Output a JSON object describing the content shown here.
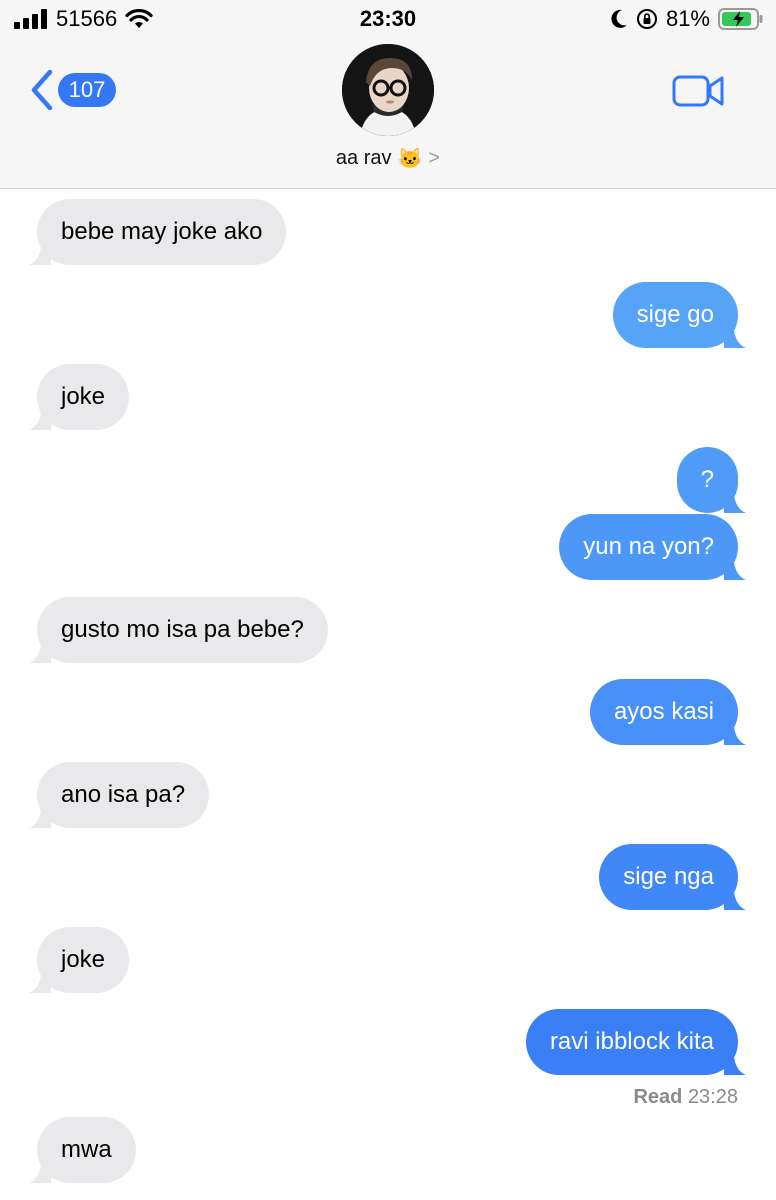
{
  "status": {
    "carrier": "51566",
    "time": "23:30",
    "battery": "81%"
  },
  "header": {
    "back_count": "107",
    "contact_name": "aa rav",
    "contact_emoji": "🐱",
    "chevron": ">"
  },
  "messages": [
    {
      "dir": "in",
      "text": "bebe may joke ako"
    },
    {
      "dir": "out",
      "text": "sige go"
    },
    {
      "dir": "in",
      "text": "joke"
    },
    {
      "dir": "out",
      "text": "?"
    },
    {
      "dir": "out",
      "text": "yun na yon?"
    },
    {
      "dir": "in",
      "text": "gusto mo isa pa bebe?"
    },
    {
      "dir": "out",
      "text": "ayos kasi"
    },
    {
      "dir": "in",
      "text": "ano isa pa?"
    },
    {
      "dir": "out",
      "text": "sige nga"
    },
    {
      "dir": "in",
      "text": "joke"
    },
    {
      "dir": "out",
      "text": "ravi ibblock kita"
    },
    {
      "dir": "in",
      "text": "mwa"
    }
  ],
  "receipt": {
    "label": "Read",
    "time": "23:28"
  },
  "colors": {
    "incoming_bubble": "#e9e9eb",
    "outgoing_top": "#5aa8f8",
    "outgoing_bottom": "#3478f6",
    "accent": "#3478f6"
  }
}
